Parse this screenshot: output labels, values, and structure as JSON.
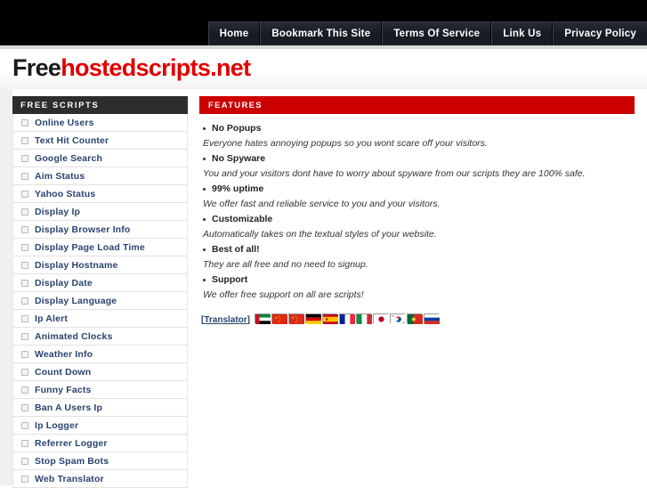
{
  "nav": {
    "items": [
      {
        "label": "Home"
      },
      {
        "label": "Bookmark This Site"
      },
      {
        "label": "Terms Of Service"
      },
      {
        "label": "Link Us"
      },
      {
        "label": "Privacy Policy"
      }
    ]
  },
  "logo": {
    "first": "Free",
    "second": "hostedscripts.net",
    "first_color": "#1a1a1a",
    "second_color": "#e10000"
  },
  "sidebar": {
    "header": "FREE SCRIPTS",
    "header_bg": "#2d2d2d",
    "link_color": "#2b4470",
    "items": [
      {
        "label": "Online Users"
      },
      {
        "label": "Text Hit Counter"
      },
      {
        "label": "Google Search"
      },
      {
        "label": "Aim Status"
      },
      {
        "label": "Yahoo Status"
      },
      {
        "label": "Display Ip"
      },
      {
        "label": "Display Browser Info"
      },
      {
        "label": "Display Page Load Time"
      },
      {
        "label": "Display Hostname"
      },
      {
        "label": "Display Date"
      },
      {
        "label": "Display Language"
      },
      {
        "label": "Ip Alert"
      },
      {
        "label": "Animated Clocks"
      },
      {
        "label": "Weather Info"
      },
      {
        "label": "Count Down"
      },
      {
        "label": "Funny Facts"
      },
      {
        "label": "Ban A Users Ip"
      },
      {
        "label": "Ip Logger"
      },
      {
        "label": "Referrer Logger"
      },
      {
        "label": "Stop Spam Bots"
      },
      {
        "label": "Web Translator"
      }
    ]
  },
  "features": {
    "header": "FEATURES",
    "header_bg": "#cc0000",
    "items": [
      {
        "title": "No Popups",
        "desc": "Everyone hates annoying popups so you wont scare off your visitors."
      },
      {
        "title": "No Spyware",
        "desc": "You and your visitors dont have to worry about spyware from our scripts they are 100% safe."
      },
      {
        "title": "99% uptime",
        "desc": "We offer fast and reliable service to you and your visitors."
      },
      {
        "title": "Customizable",
        "desc": "Automatically takes on the textual styles of your website."
      },
      {
        "title": "Best of all!",
        "desc": "They are all free and no need to signup."
      },
      {
        "title": "Support",
        "desc": "We offer free support on all are scripts!"
      }
    ]
  },
  "translator": {
    "label": "[Translator]",
    "flags": [
      {
        "name": "flag-uae-icon",
        "country": "United Arab Emirates"
      },
      {
        "name": "flag-china-icon",
        "country": "China"
      },
      {
        "name": "flag-china-traditional-icon",
        "country": "China Traditional"
      },
      {
        "name": "flag-germany-icon",
        "country": "Germany"
      },
      {
        "name": "flag-spain-icon",
        "country": "Spain"
      },
      {
        "name": "flag-france-icon",
        "country": "France"
      },
      {
        "name": "flag-italy-icon",
        "country": "Italy"
      },
      {
        "name": "flag-japan-icon",
        "country": "Japan"
      },
      {
        "name": "flag-south-korea-icon",
        "country": "South Korea"
      },
      {
        "name": "flag-portugal-icon",
        "country": "Portugal"
      },
      {
        "name": "flag-russia-icon",
        "country": "Russia"
      }
    ]
  }
}
